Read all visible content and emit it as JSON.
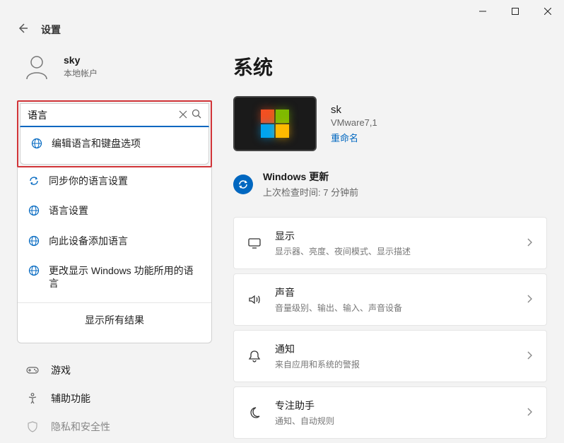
{
  "window": {
    "app_title": "设置"
  },
  "profile": {
    "name": "sky",
    "subtitle": "本地帐户"
  },
  "search": {
    "value": "语言",
    "suggestions": [
      "编辑语言和键盘选项",
      "同步你的语言设置",
      "语言设置",
      "向此设备添加语言",
      "更改显示 Windows 功能所用的语言"
    ],
    "footer": "显示所有结果"
  },
  "nav": {
    "games": "游戏",
    "accessibility": "辅助功能",
    "privacy": "隐私和安全性"
  },
  "page": {
    "title": "系统"
  },
  "device": {
    "name": "sk",
    "model": "VMware7,1",
    "rename": "重命名"
  },
  "update": {
    "title": "Windows 更新",
    "sub": "上次检查时间: 7 分钟前"
  },
  "cards": {
    "display": {
      "title": "显示",
      "sub": "显示器、亮度、夜间模式、显示描述"
    },
    "sound": {
      "title": "声音",
      "sub": "音量级别、输出、输入、声音设备"
    },
    "notifications": {
      "title": "通知",
      "sub": "来自应用和系统的警报"
    },
    "focus": {
      "title": "专注助手",
      "sub": "通知、自动规则"
    }
  }
}
